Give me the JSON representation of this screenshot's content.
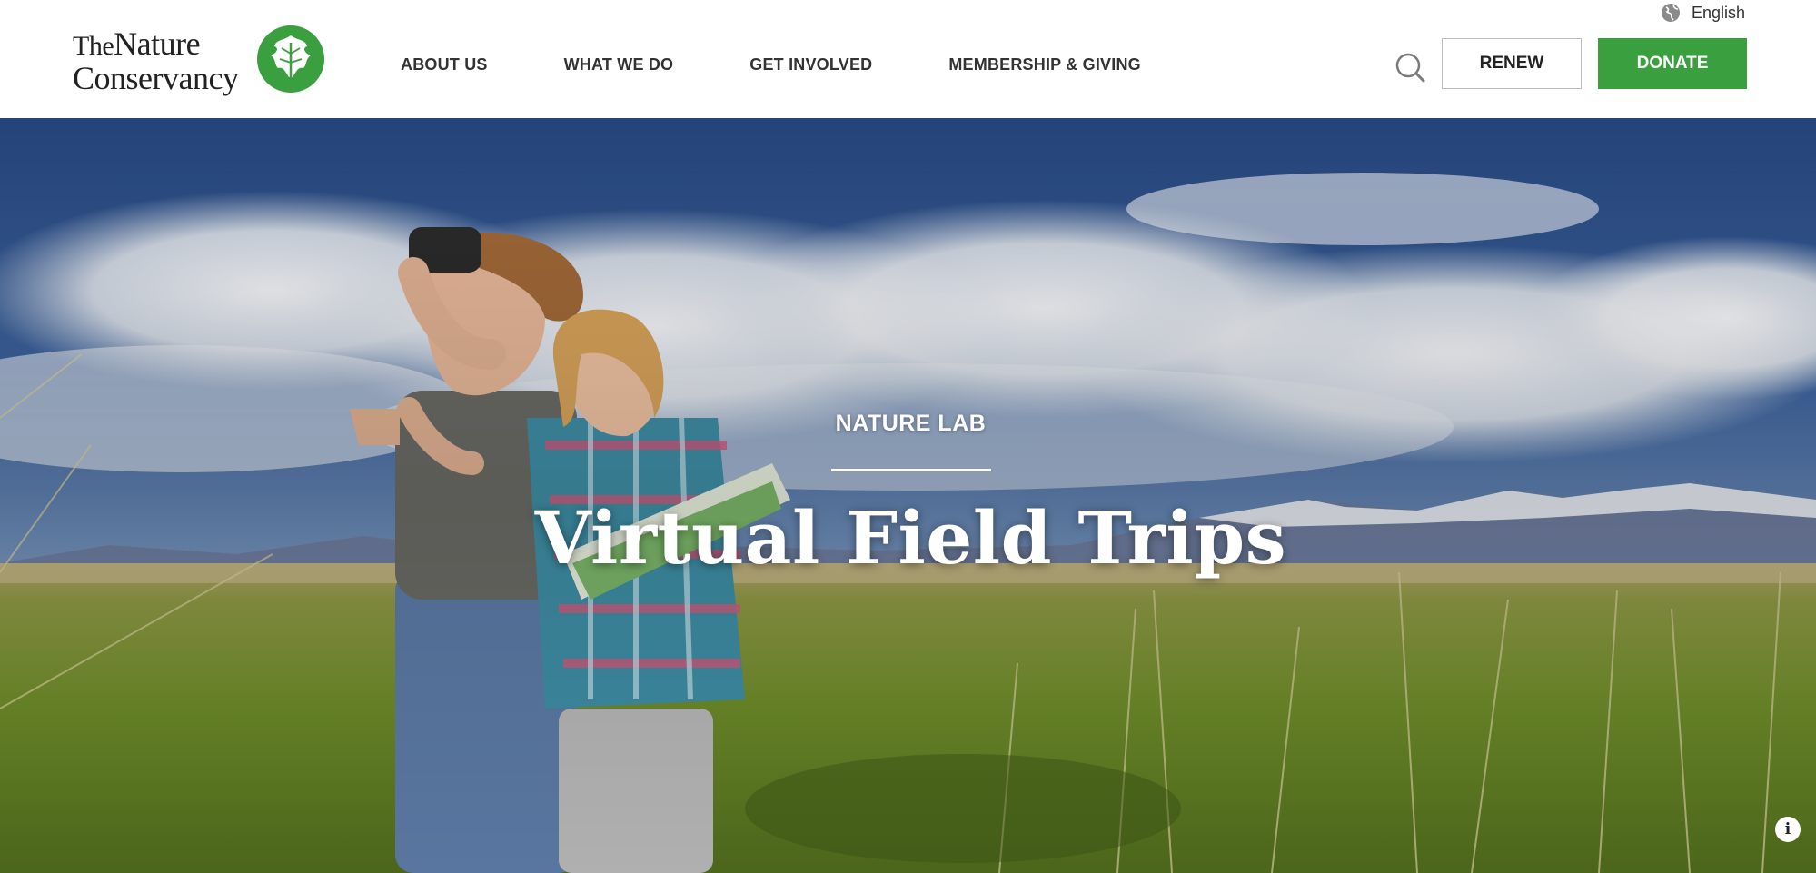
{
  "header": {
    "logo": {
      "line1_the": "The",
      "line1_rest": "Nature",
      "line2": "Conservancy",
      "brand_green": "#3a9f3e"
    },
    "language": {
      "label": "English",
      "icon": "globe-icon"
    },
    "nav": {
      "items": [
        {
          "label": "ABOUT US"
        },
        {
          "label": "WHAT WE DO"
        },
        {
          "label": "GET INVOLVED"
        },
        {
          "label": "MEMBERSHIP & GIVING"
        }
      ]
    },
    "search": {
      "icon": "search-icon"
    },
    "renew_label": "RENEW",
    "donate_label": "DONATE",
    "donate_color": "#3a9f3e"
  },
  "hero": {
    "eyebrow": "NATURE LAB",
    "title": "Virtual Field Trips",
    "info_label": "i"
  }
}
